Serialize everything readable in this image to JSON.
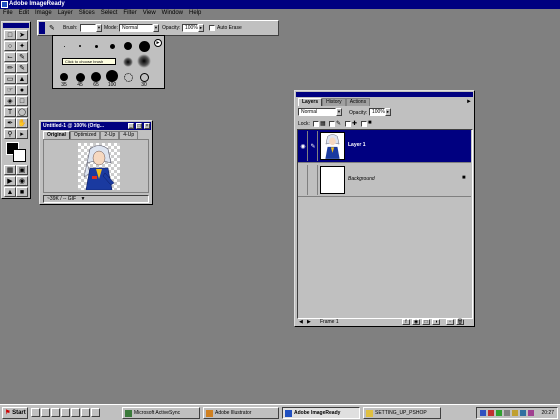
{
  "app": {
    "title": "Adobe ImageReady"
  },
  "menu": [
    "File",
    "Edit",
    "Image",
    "Layer",
    "Slices",
    "Select",
    "Filter",
    "View",
    "Window",
    "Help"
  ],
  "options": {
    "brush_label": "Brush:",
    "mode_label": "Mode:",
    "mode_value": "Normal",
    "opacity_label": "Opacity:",
    "opacity_value": "100%",
    "auto_erase": "Auto Erase"
  },
  "brushes": {
    "tooltip": "Click to choose brush",
    "numbers": [
      "35",
      "45",
      "65",
      "100",
      "",
      "30"
    ]
  },
  "document": {
    "title": "Untitled-1 @ 100% (Orig...",
    "tabs": [
      "Original",
      "Optimized",
      "2-Up",
      "4-Up"
    ],
    "status_zoom": "~39K",
    "status_format": "/ -- GIF"
  },
  "layers_palette": {
    "tabs": [
      "Layers",
      "History",
      "Actions"
    ],
    "blend_mode": "Normal",
    "opacity_label": "Opacity:",
    "opacity_value": "100%",
    "lock_label": "Lock:",
    "layers": [
      {
        "name": "Layer 1",
        "selected": true
      },
      {
        "name": "Background",
        "selected": false
      }
    ],
    "frame_label": "Frame 1"
  },
  "taskbar": {
    "start": "Start",
    "buttons": [
      "Microsoft ActiveSync",
      "Adobe Illustrator",
      "Adobe ImageReady",
      "SETTING_UP_PSHOP"
    ],
    "active": "Adobe ImageReady",
    "clock": "20:27"
  },
  "colors": {
    "titlebar": "#000080",
    "desktop": "#808080",
    "face": "#c0c0c0"
  }
}
